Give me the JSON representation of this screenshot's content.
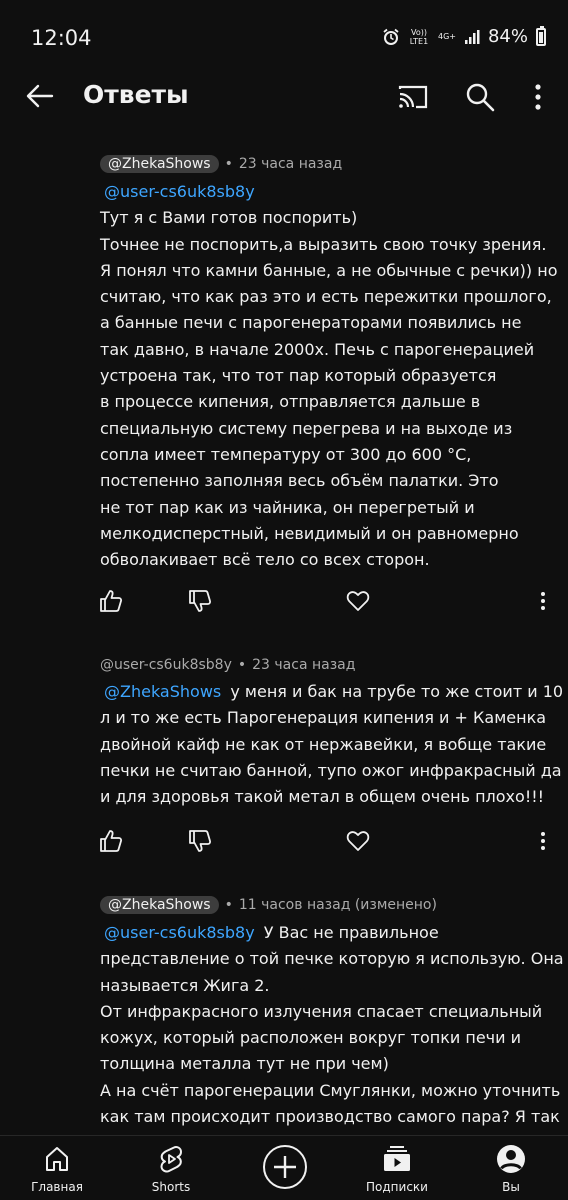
{
  "status_bar": {
    "time": "12:04",
    "network_volte": "Vo)) LTE1",
    "network_4g": "4G+",
    "battery_pct": "84%",
    "battery_level": 0.84
  },
  "header": {
    "title": "Ответы"
  },
  "comments": [
    {
      "author": "@ZhekaShows",
      "time": "23 часа назад",
      "mention": "@user-cs6uk8sb8y",
      "lines": [
        "Тут я с Вами готов поспорить)",
        "Точнее не поспорить,а выразить свою точку зрения.",
        "Я понял что камни банные, а не обычные с речки)) но",
        "считаю, что как раз это и есть пережитки прошлого,",
        "а банные печи с парогенераторами появились не",
        "так давно, в начале 2000х. Печь с парогенерацией",
        "устроена так, что тот пар который образуется",
        "в процессе кипения, отправляется дальше в",
        "специальную систему перегрева и на выходе из",
        "сопла имеет температуру от 300 до 600 °С,",
        "постепенно заполняя весь объём палатки. Это",
        "не тот пар как из чайника, он перегретый и",
        "мелкодисперстный, невидимый и он равномерно",
        "обволакивает всё тело со всех сторон."
      ]
    },
    {
      "author": "@user-cs6uk8sb8y",
      "time": "23 часа назад",
      "mention": "@ZhekaShows",
      "first_line_rest": "у меня и бак на трубе то же стоит и 10",
      "lines": [
        "л и то же есть Парогенерация кипения и + Каменка",
        "двойной кайф не как от нержавейки, я вобще такие",
        "печки не считаю банной, тупо ожог инфракрасный да",
        "и для здоровья такой метал в общем очень плохо!!!"
      ]
    },
    {
      "author": "@ZhekaShows",
      "time": "11 часов назад (изменено)",
      "mention": "@user-cs6uk8sb8y",
      "first_line_rest": "У Вас не правильное",
      "lines": [
        "представление о той печке которую я использую. Она",
        "называется Жига 2.",
        "От инфракрасного излучения спасает специальный",
        "кожух, который расположен вокруг топки печи и",
        "толщина металла тут не при чем)",
        "А на счёт парогенерации Смуглянки, можно уточнить",
        "как там происходит производство самого пара? Я так"
      ]
    }
  ],
  "meta_separator": "•",
  "bottom_nav": {
    "home": "Главная",
    "shorts": "Shorts",
    "subscriptions": "Подписки",
    "you": "Вы"
  }
}
